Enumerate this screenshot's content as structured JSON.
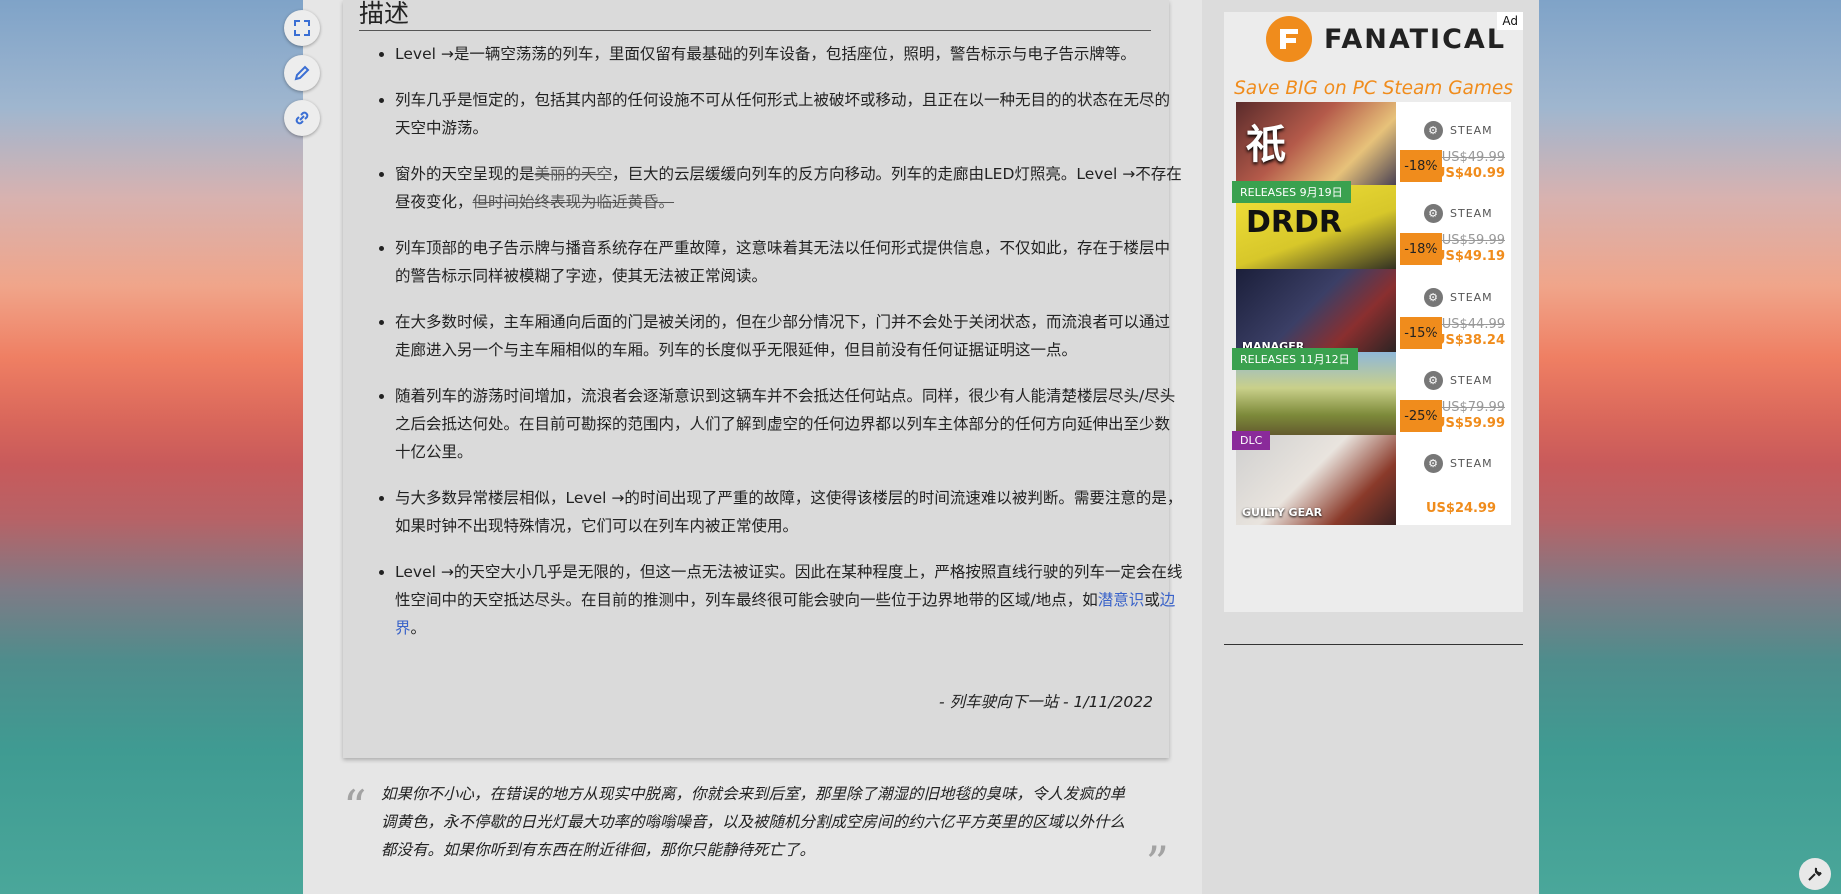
{
  "article": {
    "heading": "描述",
    "items": [
      [
        {
          "t": "Level →是一辆空荡荡的列车，里面仅留有最基础的列车设备，包括座位，照明，警告标示与电子告示牌等。",
          "s": "n"
        }
      ],
      [
        {
          "t": "列车几乎是恒定的，包括其内部的任何设施不可从任何形式上被破坏或移动，且正在以一种无目的的状态在无尽的天空中游荡。",
          "s": "n"
        }
      ],
      [
        {
          "t": "窗外的天空呈现的是",
          "s": "n"
        },
        {
          "t": "美丽的天空",
          "s": "strike"
        },
        {
          "t": "，巨大的云层缓缓向列车的反方向移动。列车的走廊由LED灯照亮。Level →不存在昼夜变化，",
          "s": "n"
        },
        {
          "t": "但时间始终表现为临近黄昏。",
          "s": "strike"
        }
      ],
      [
        {
          "t": "列车顶部的电子告示牌与播音系统存在严重故障，这意味着其无法以任何形式提供信息，不仅如此，存在于楼层中的警告标示同样被模糊了字迹，使其无法被正常阅读。",
          "s": "n"
        }
      ],
      [
        {
          "t": "在大多数时候，主车厢通向后面的门是被关闭的，但在少部分情况下，门并不会处于关闭状态，而流浪者可以通过走廊进入另一个与主车厢相似的车厢。列车的长度似乎无限延伸，但目前没有任何证据证明这一点。",
          "s": "n"
        }
      ],
      [
        {
          "t": "随着列车的游荡时间增加，流浪者会逐渐意识到这辆车并不会抵达任何站点。同样，很少有人能清楚楼层尽头/尽头之后会抵达何处。在目前可勘探的范围内，人们了解到虚空的任何边界都以列车主体部分的任何方向延伸出至少数十亿公里。",
          "s": "n"
        }
      ],
      [
        {
          "t": "与大多数异常楼层相似，Level →的时间出现了严重的故障，这使得该楼层的时间流速难以被判断。需要注意的是，如果时钟不出现特殊情况，它们可以在列车内被正常使用。",
          "s": "n"
        }
      ],
      [
        {
          "t": "Level →的天空大小几乎是无限的，但这一点无法被证实。因此在某种程度上，严格按照直线行驶的列车一定会在线性空间中的天空抵达尽头。在目前的推测中，列车最终很可能会驶向一些位于边界地带的区域/地点，如",
          "s": "n"
        },
        {
          "t": "潜意识",
          "s": "link"
        },
        {
          "t": "或",
          "s": "n"
        },
        {
          "t": "边界",
          "s": "link"
        },
        {
          "t": "。",
          "s": "n"
        }
      ]
    ],
    "signature": "- 列车驶向下一站 - 1/11/2022"
  },
  "quote": {
    "open_mark": "“",
    "close_mark": "”",
    "text": "如果你不小心，在错误的地方从现实中脱离，你就会来到后室，那里除了潮湿的旧地毯的臭味，令人发疯的单调黄色，永不停歇的日光灯最大功率的嗡嗡噪音，以及被随机分割成空房间的约六亿平方英里的区域以外什么都没有。如果你听到有东西在附近徘徊，那你只能静待死亡了。"
  },
  "toolbar": {
    "icons": [
      "fullscreen-icon",
      "edit-pencil-icon",
      "link-icon"
    ]
  },
  "ad": {
    "tag": "Ad",
    "brand": "FANATICAL",
    "tagline": "Save BIG on PC Steam Games",
    "brand_color": "#f08c1c",
    "tiles": [
      {
        "ribbon": "",
        "ribbon_type": "",
        "art_title": "",
        "art_bg": "linear-gradient(135deg,#5a2b2b,#b45a4a 40%,#e7c27a 70%,#3a3550)",
        "art_glyph": "祇",
        "platform": "STEAM",
        "discount": "-18%",
        "old_price": "US$49.99",
        "new_price": "US$40.99"
      },
      {
        "ribbon": "RELEASES 9月19日",
        "ribbon_type": "release",
        "art_title": "DRDR",
        "art_bg": "linear-gradient(160deg,#f3e23a,#d7c72a 55%,#222 100%)",
        "art_glyph": "",
        "platform": "STEAM",
        "discount": "-18%",
        "old_price": "US$59.99",
        "new_price": "US$49.19"
      },
      {
        "ribbon": "",
        "ribbon_type": "",
        "art_title": "MANAGER",
        "art_bg": "linear-gradient(135deg,#1b1f3a,#3b3f66 45%,#8a2f2f 70%,#222 100%)",
        "art_glyph": "",
        "platform": "STEAM",
        "discount": "-15%",
        "old_price": "US$44.99",
        "new_price": "US$38.24"
      },
      {
        "ribbon": "RELEASES 11月12日",
        "ribbon_type": "release",
        "art_title": "",
        "art_bg": "linear-gradient(180deg,#8fb7d8,#c9d08a 40%,#7d8a3a 70%,#5a4a2a 100%)",
        "art_glyph": "",
        "platform": "STEAM",
        "discount": "-25%",
        "old_price": "US$79.99",
        "new_price": "US$59.99"
      },
      {
        "ribbon": "DLC",
        "ribbon_type": "dlc",
        "art_title": "GUILTY GEAR",
        "art_bg": "linear-gradient(135deg,#cfcfcf,#e9e4de 45%,#8a3a2a 75%,#3a2222 100%)",
        "art_glyph": "",
        "platform": "STEAM",
        "discount": "",
        "old_price": "",
        "new_price": "US$24.99"
      }
    ]
  }
}
